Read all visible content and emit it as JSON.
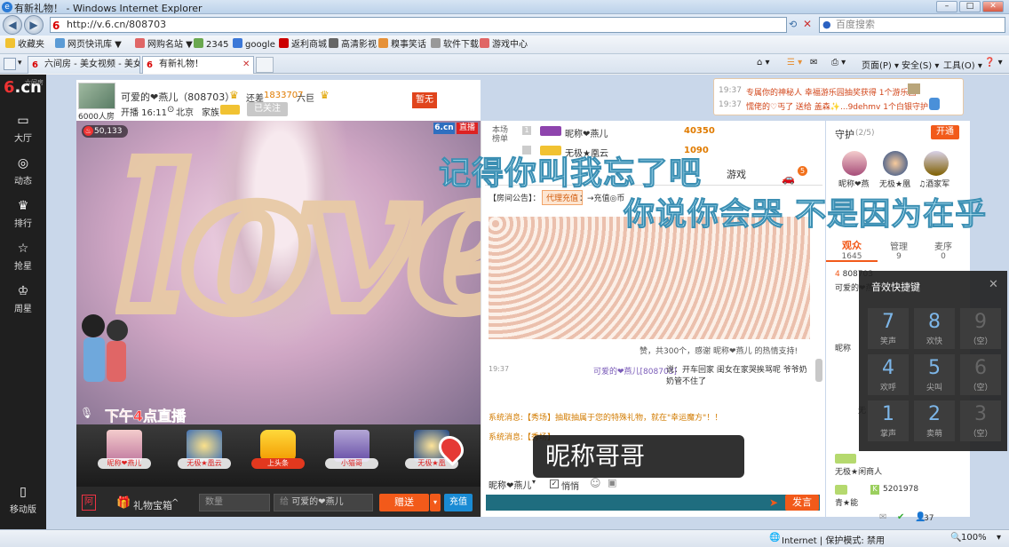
{
  "window": {
    "title": "有新礼物！ - Windows Internet Explorer"
  },
  "address": {
    "url": "http://v.6.cn/808703",
    "search_placeholder": "百度搜索"
  },
  "favorites": {
    "label": "收藏夹",
    "items": [
      "网页快讯库 ▼",
      "网购名站 ▼",
      "2345",
      "google",
      "返利商城",
      "高清影视",
      "糗事笑话",
      "软件下载",
      "游戏中心"
    ]
  },
  "tabs": [
    {
      "label": "六间房 - 美女视频 - 美女..."
    },
    {
      "label": "有新礼物！"
    }
  ],
  "command_bar": {
    "page": "页面(P) ▾",
    "safety": "安全(S) ▾",
    "tools": "工具(O) ▾",
    "help": "❓ ▾"
  },
  "sidebar": {
    "logo": "6.cn",
    "logo_sub": "六间房",
    "items": [
      "大厅",
      "动态",
      "排行",
      "抢星",
      "周星"
    ],
    "mobile": "移动版"
  },
  "streamer": {
    "name": "可爱的❤燕儿（808703）",
    "room_type": "6000人房",
    "rank_label": "还差",
    "rank_value": "1833707",
    "rank_suffix": "六巨",
    "start_time": "开播 16:11",
    "location": "北京",
    "family_label": "家族",
    "follow_label": "已关注",
    "badge_zanwu": "暂无",
    "viewers": "50,133",
    "site_tag": "6.cn",
    "live_tag": "直播",
    "overlay_text": "下午4点直播"
  },
  "gifts": [
    {
      "label": "昵称❤燕儿"
    },
    {
      "label": "无极★凰云"
    },
    {
      "label": "上头条"
    },
    {
      "label": "小猫哥"
    },
    {
      "label": "无极★凰"
    }
  ],
  "controls": {
    "gift_box": "礼物宝箱",
    "qty_placeholder": "数量",
    "to_label": "给",
    "to_value": "可爱的❤燕儿",
    "send": "赠送",
    "recharge": "充值"
  },
  "chat": {
    "rank_label": "本场\n榜单",
    "rank_1_name": "昵称❤燕儿",
    "rank_1_value": "40350",
    "rank_2_name": "无极★凰云",
    "rank_2_value": "1090",
    "games_tab": "游戏",
    "games_badge": "5",
    "announcement_label": "【房间公告】：",
    "announcement_link": "代理充值",
    "announcement_text": "：→充值◎币",
    "thanks_line": "赞，共300个，感谢 昵称❤燕儿 的热情支持!",
    "msg1_time": "19:37",
    "msg1_user": "可爱的❤燕儿[808703]",
    "msg1_text": "说：开车回家 闺女在家哭挨骂呢 爷爷奶奶管不住了",
    "system1": "系统消息:【秀场】抽取抽属于您的特殊礼物，就在\"幸运魔方\"！！",
    "system2": "系统消息:【秀场】",
    "me_label": "昵称❤燕儿",
    "whisper": "悄悄",
    "send_btn": "发言"
  },
  "notice": {
    "line1_time": "19:37",
    "line1_text": "专属你的神秘人 幸福游乐园抽奖获得 1个游乐园",
    "line2_time": "19:37",
    "line2_text": "懦佬的♡丐了 送给 盖森✨...9dehmv 1个白银守护"
  },
  "guard": {
    "title": "守护",
    "count": "(2/5)",
    "open_btn": "开通",
    "members": [
      "昵称❤燕",
      "无极★凰",
      "♫酒家军"
    ]
  },
  "audience": {
    "tabs": [
      {
        "label": "观众",
        "count": "1645"
      },
      {
        "label": "管理",
        "count": "9"
      },
      {
        "label": "麦序",
        "count": "0"
      }
    ],
    "rows": [
      "808703",
      "可爱的❤燕",
      "昵称",
      "无",
      "无极★闲商人",
      "5201978",
      "青★能"
    ],
    "footer_count": "37"
  },
  "fx_panel": {
    "title": "音效快捷键",
    "keys": [
      {
        "n": "7",
        "label": "笑声"
      },
      {
        "n": "8",
        "label": "欢快"
      },
      {
        "n": "9",
        "label": "（空）"
      },
      {
        "n": "4",
        "label": "欢呼"
      },
      {
        "n": "5",
        "label": "尖叫"
      },
      {
        "n": "6",
        "label": "（空）"
      },
      {
        "n": "1",
        "label": "掌声"
      },
      {
        "n": "2",
        "label": "卖萌"
      },
      {
        "n": "3",
        "label": "（空）"
      }
    ]
  },
  "lyrics": {
    "line1": "记得你叫我忘了吧",
    "line2": "你说你会哭 不是因为在乎"
  },
  "popup": {
    "nickname": "昵称哥哥"
  },
  "statusbar": {
    "zone": "Internet | 保护模式: 禁用",
    "zoom": "100%"
  }
}
